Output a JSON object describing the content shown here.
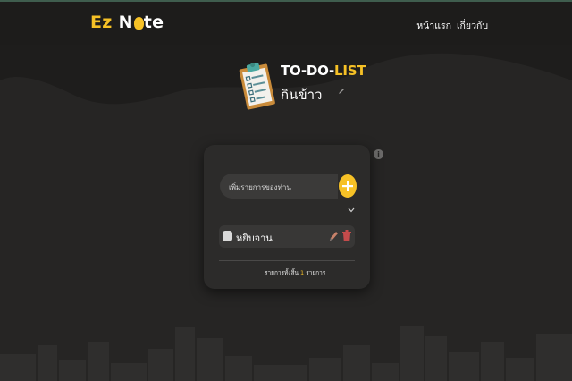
{
  "brand": {
    "logo_ez": "Ez",
    "logo_n": "N",
    "logo_te": "te",
    "accent": "#f6c126"
  },
  "nav": {
    "home": "หน้าแรก",
    "about": "เกี่ยวกับ"
  },
  "list": {
    "title_part1": "TO-DO-",
    "title_part2": "LIST",
    "name": "กินข้าว"
  },
  "add": {
    "placeholder": "เพิ่มรายการของท่าน",
    "button_icon": "plus-icon"
  },
  "items": [
    {
      "label": "หยิบจาน",
      "checked": false
    }
  ],
  "footer": {
    "prefix": "รายการทั้งสิ้น",
    "count": "1",
    "suffix": "รายการ"
  },
  "colors": {
    "background": "#262524",
    "header": "#1d1c1b",
    "card": "#2c2b2a"
  }
}
